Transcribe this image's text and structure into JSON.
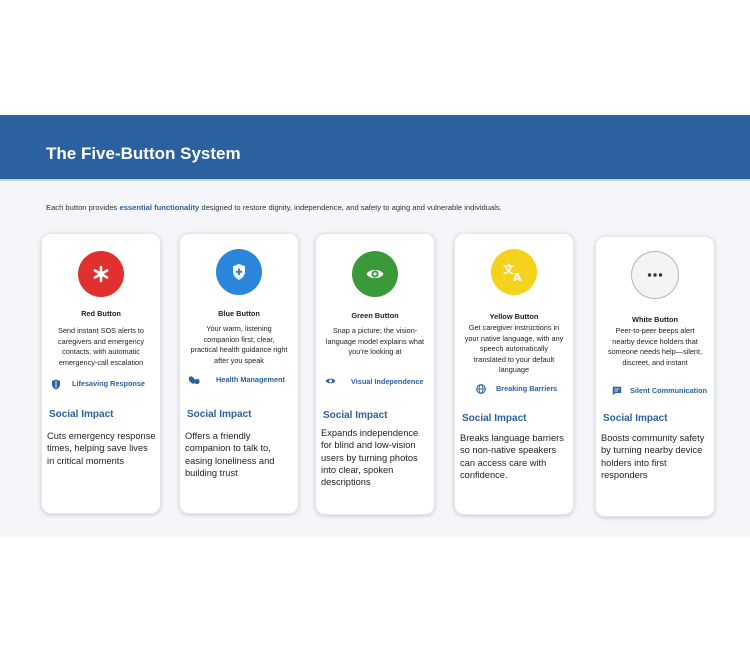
{
  "header": {
    "title": "The Five-Button System"
  },
  "intro": {
    "before": "Each button provides ",
    "highlight": "essential functionality",
    "after": " designed to restore dignity, independence, and safety to aging and vulnerable individuals."
  },
  "colors": {
    "header_bg": "#2b619f",
    "red": "#e03030",
    "blue": "#2b86db",
    "green": "#3a9a3a",
    "yellow": "#f5d21c",
    "white": "#f4f4f4"
  },
  "cards": [
    {
      "title": "Red Button",
      "icon": "asterisk-icon",
      "description": "Send instant SOS alerts to caregivers and emergency contacts, with automatic emergency-call escalation",
      "feature_icon": "shield-icon",
      "feature": "Lifesaving Response",
      "impact_heading": "Social Impact",
      "impact": "Cuts emergency response times, helping save lives in critical moments"
    },
    {
      "title": "Blue Button",
      "icon": "medical-shield-icon",
      "description": "Your warm, listening companion first; clear, practical health guidance right after you speak",
      "feature_icon": "pills-icon",
      "feature": "Health Management",
      "impact_heading": "Social Impact",
      "impact": "Offers a friendly companion to talk to, easing loneliness and building trust"
    },
    {
      "title": "Green Button",
      "icon": "eye-icon",
      "description": "Snap a picture; the vision-language model explains what you're looking at",
      "feature_icon": "eye-icon",
      "feature": "Visual Independence",
      "impact_heading": "Social Impact",
      "impact": "Expands independence for blind and low-vision users by turning photos into clear, spoken descriptions"
    },
    {
      "title": "Yellow Button",
      "icon": "translate-icon",
      "description": "Get caregiver instructions in your native language, with any speech automatically translated to your default language",
      "feature_icon": "globe-icon",
      "feature": "Breaking Barriers",
      "impact_heading": "Social Impact",
      "impact": "Breaks language barriers so non-native speakers can access care with confidence."
    },
    {
      "title": "White Button",
      "icon": "more-dots-icon",
      "description": "Peer-to-peer beeps alert nearby device holders that someone needs help—silent, discreet, and instant",
      "feature_icon": "chat-icon",
      "feature": "Silent Communication",
      "impact_heading": "Social Impact",
      "impact": "Boosts community safety by turning nearby device holders into first responders"
    }
  ]
}
